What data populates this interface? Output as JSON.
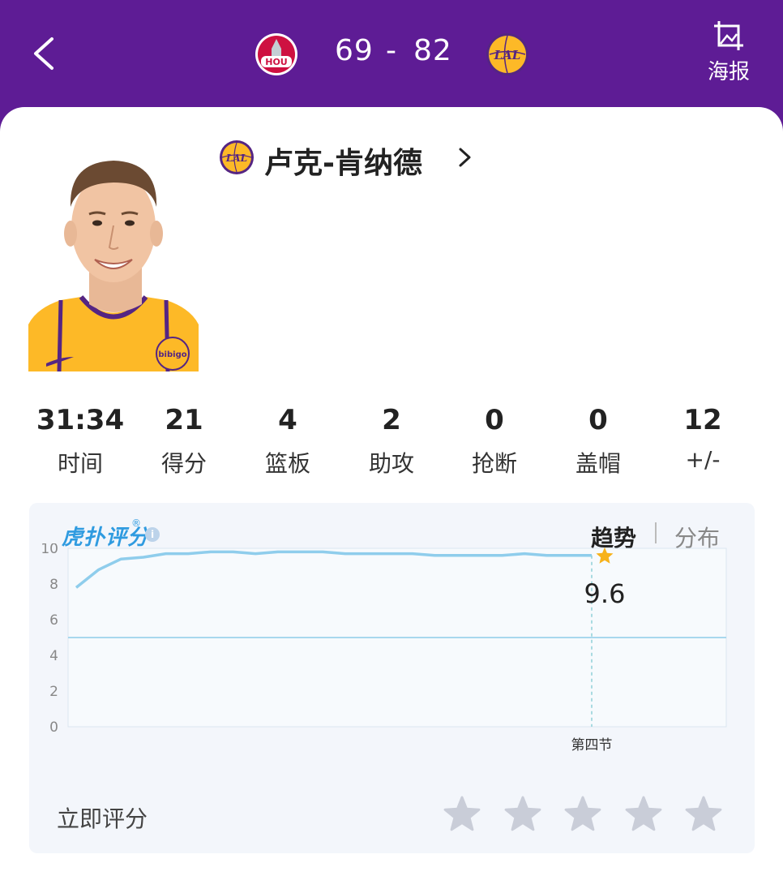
{
  "header": {
    "home_team": "HOU",
    "away_team": "LAL",
    "home_score": "69",
    "separator": "-",
    "away_score": "82",
    "poster_label": "海报",
    "bg_color": "#5e1c95"
  },
  "player": {
    "name": "卢克-肯纳德",
    "jersey_sponsor": "bibigo"
  },
  "stats": [
    {
      "value": "31:34",
      "label": "时间"
    },
    {
      "value": "21",
      "label": "得分"
    },
    {
      "value": "4",
      "label": "篮板"
    },
    {
      "value": "2",
      "label": "助攻"
    },
    {
      "value": "0",
      "label": "抢断"
    },
    {
      "value": "0",
      "label": "盖帽"
    },
    {
      "value": "12",
      "label": "+/-"
    }
  ],
  "rating": {
    "brand": "虎扑评分",
    "brand_mark": "®",
    "tab_trend": "趋势",
    "tab_distribution": "分布",
    "current_score": "9.6",
    "rate_now_label": "立即评分",
    "stars_total": 5,
    "accent_color": "#2f9be0",
    "star_color": "#f7b21a"
  },
  "chart_data": {
    "type": "line",
    "ylim": [
      0,
      10
    ],
    "y_ticks": [
      "0",
      "2",
      "4",
      "6",
      "8",
      "10"
    ],
    "x_marker_label": "第四节",
    "reference_line": 5,
    "series": [
      {
        "values": [
          7.8,
          8.8,
          9.4,
          9.5,
          9.7,
          9.7,
          9.8,
          9.8,
          9.7,
          9.8,
          9.8,
          9.8,
          9.7,
          9.7,
          9.7,
          9.7,
          9.6,
          9.6,
          9.6,
          9.6,
          9.7,
          9.6,
          9.6,
          9.6
        ]
      }
    ],
    "final_value": "9.6"
  }
}
